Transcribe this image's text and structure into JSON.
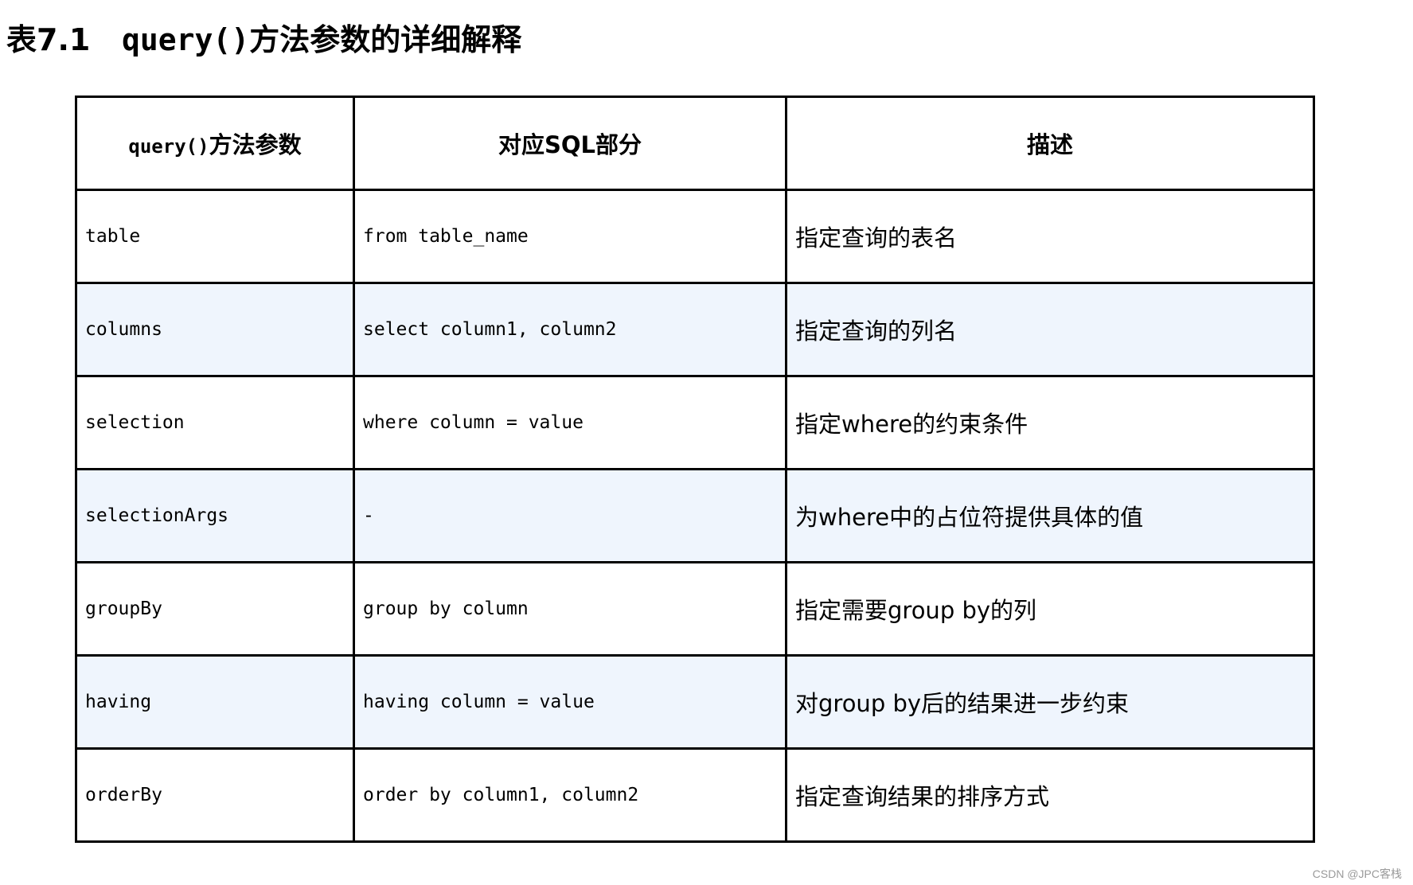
{
  "title": {
    "prefix": "表7.1",
    "method": "query()",
    "suffix": "方法参数的详细解释"
  },
  "table": {
    "headers": {
      "param_code": "query()",
      "param_text": "方法参数",
      "sql": "对应SQL部分",
      "desc": "描述"
    },
    "row_shading_color": "#eff5fd",
    "rows": [
      {
        "param": "table",
        "sql": "from table_name",
        "desc": "指定查询的表名",
        "shaded": false
      },
      {
        "param": "columns",
        "sql": "select column1, column2",
        "desc": "指定查询的列名",
        "shaded": true
      },
      {
        "param": "selection",
        "sql": "where column = value",
        "desc": "指定where的约束条件",
        "shaded": false
      },
      {
        "param": "selectionArgs",
        "sql": "-",
        "desc": "为where中的占位符提供具体的值",
        "shaded": true
      },
      {
        "param": "groupBy",
        "sql": "group by column",
        "desc": "指定需要group by的列",
        "shaded": false
      },
      {
        "param": "having",
        "sql": "having column = value",
        "desc": "对group by后的结果进一步约束",
        "shaded": true
      },
      {
        "param": "orderBy",
        "sql": "order by column1, column2",
        "desc": "指定查询结果的排序方式",
        "shaded": false
      }
    ]
  },
  "watermark": "CSDN @JPC客栈"
}
